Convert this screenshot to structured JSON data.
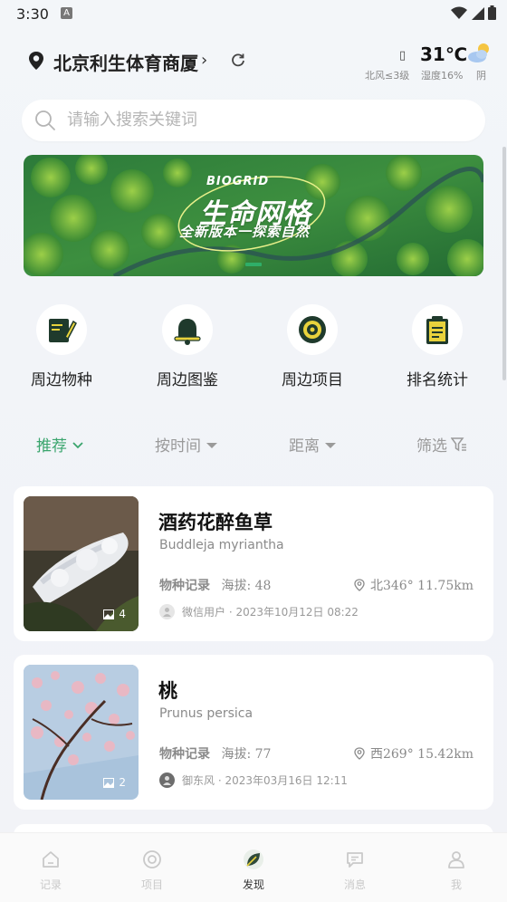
{
  "status_bar": {
    "time": "3:30",
    "notif": "A"
  },
  "location": {
    "name": "北京利生体育商厦",
    "chevron": "›"
  },
  "weather": {
    "temp": "31℃",
    "wind": "北风≤3级",
    "humidity": "湿度16%",
    "condition": "阴",
    "icon": "cloud-sun-icon"
  },
  "search": {
    "placeholder": "请输入搜索关键词"
  },
  "banner": {
    "brand": "BIOGRID",
    "title": "生命网格",
    "subtitle": "全新版本一探索自然"
  },
  "quick_actions": [
    {
      "label": "周边物种",
      "icon": "notebook-pen-icon"
    },
    {
      "label": "周边图鉴",
      "icon": "bell-icon"
    },
    {
      "label": "周边项目",
      "icon": "target-icon"
    },
    {
      "label": "排名统计",
      "icon": "clipboard-icon"
    }
  ],
  "filters": [
    {
      "label": "推荐",
      "icon": "chevron-down-icon"
    },
    {
      "label": "按时间",
      "icon": "caret-down-icon"
    },
    {
      "label": "距离",
      "icon": "caret-down-icon"
    },
    {
      "label": "筛选",
      "icon": "filter-icon"
    }
  ],
  "records": [
    {
      "name": "酒药花醉鱼草",
      "latin": "Buddleja myriantha",
      "meta_label": "物种记录",
      "altitude": "海拔: 48",
      "direction": "北346° 11.75km",
      "user": "微信用户 · 2023年10月12日 08:22",
      "image_count": "4"
    },
    {
      "name": "桃",
      "latin": "Prunus persica",
      "meta_label": "物种记录",
      "altitude": "海拔: 77",
      "direction": "西269° 15.42km",
      "user": "御东风 · 2023年03月16日 12:11",
      "image_count": "2"
    }
  ],
  "bottom_nav": [
    {
      "label": "记录",
      "icon": "home-icon"
    },
    {
      "label": "项目",
      "icon": "target-icon"
    },
    {
      "label": "发现",
      "icon": "leaf-icon"
    },
    {
      "label": "消息",
      "icon": "chat-icon"
    },
    {
      "label": "我",
      "icon": "user-icon"
    }
  ],
  "colors": {
    "accent": "#3aa56d",
    "icon_dark": "#1f3a2c",
    "icon_yellow": "#e8d23c"
  }
}
